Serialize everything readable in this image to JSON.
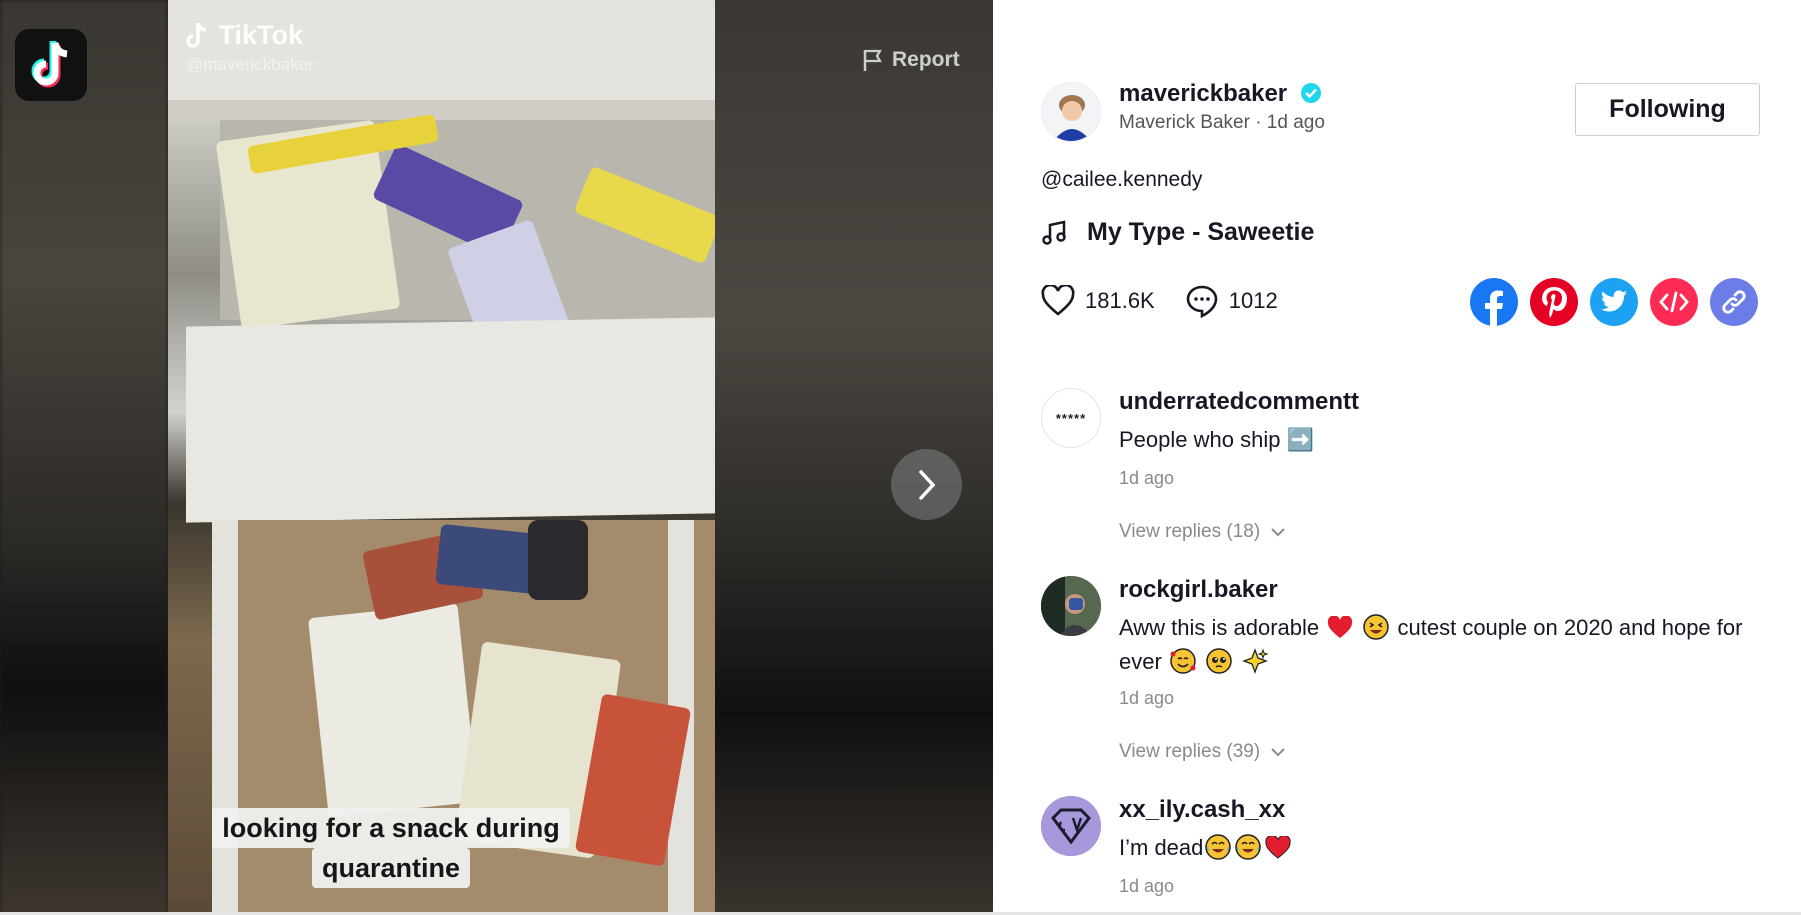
{
  "video": {
    "watermark_title": "TikTok",
    "watermark_handle": "@maverickbaker",
    "report_label": "Report",
    "caption_line1": "looking for a snack during",
    "caption_line2": "quarantine"
  },
  "author": {
    "username": "maverickbaker",
    "display_meta": "Maverick Baker · 1d ago",
    "verified": true,
    "follow_label": "Following"
  },
  "post": {
    "description": "@cailee.kennedy",
    "music": "My Type - Saweetie",
    "likes": "181.6K",
    "comments": "1012"
  },
  "share": {
    "icons": [
      "facebook-icon",
      "pinterest-icon",
      "twitter-icon",
      "embed-icon",
      "copy-link-icon"
    ],
    "colors": {
      "facebook": "#1877f2",
      "pinterest": "#e60023",
      "twitter": "#1da1f2",
      "embed": "#fe2c55",
      "link": "#6d7de8"
    }
  },
  "comments": [
    {
      "username": "underratedcommentt",
      "avatar_text": "*****",
      "text": "People who ship ➡️",
      "time": "1d ago",
      "replies": "View replies (18)"
    },
    {
      "username": "rockgirl.baker",
      "text_parts": [
        "Aww this is adorable",
        "cutest couple on 2020 and hope",
        "for ever"
      ],
      "time": "1d ago",
      "replies": "View replies (39)"
    },
    {
      "username": "xx_ily.cash_xx",
      "text": "I’m dead",
      "time": "1d ago"
    }
  ],
  "colors": {
    "accent_verified": "#20d5ec",
    "text_primary": "#161823",
    "text_secondary": "#8a8a8a"
  }
}
